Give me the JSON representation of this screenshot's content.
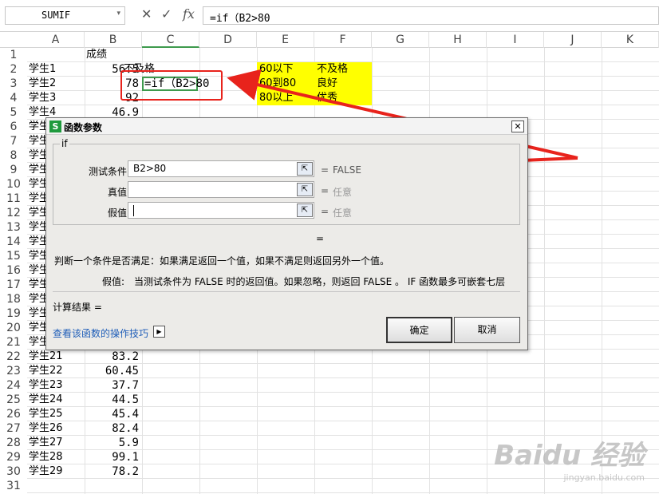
{
  "formula_bar": {
    "name_box": "SUMIF",
    "cancel_icon": "✕",
    "enter_icon": "✓",
    "fx_icon": "fx",
    "formula": "=if（B2>80"
  },
  "columns": [
    "A",
    "B",
    "C",
    "D",
    "E",
    "F",
    "G",
    "H",
    "I",
    "J",
    "K"
  ],
  "rows": [
    "1",
    "2",
    "3",
    "4",
    "5",
    "6",
    "7",
    "8",
    "9",
    "10",
    "11",
    "12",
    "13",
    "14",
    "15",
    "16",
    "17",
    "18",
    "19",
    "20",
    "21",
    "22",
    "23",
    "24",
    "25",
    "26",
    "27",
    "28",
    "29",
    "30",
    "31"
  ],
  "sheet": {
    "b1": "成绩",
    "visible_rows_top": [
      {
        "a": "学生1",
        "b": "56.5",
        "c": "不及格"
      },
      {
        "a": "学生2",
        "b": "78",
        "c": "=if（B2>80"
      },
      {
        "a": "学生3",
        "b": "92"
      },
      {
        "a": "学生4",
        "b": "46.9"
      }
    ],
    "hidden_a_prefix": "学生",
    "visible_rows_bottom": [
      {
        "a": "学生21",
        "b": "83.2"
      },
      {
        "a": "学生22",
        "b": "60.45"
      },
      {
        "a": "学生23",
        "b": "37.7"
      },
      {
        "a": "学生24",
        "b": "44.5"
      },
      {
        "a": "学生25",
        "b": "45.4"
      },
      {
        "a": "学生26",
        "b": "82.4"
      },
      {
        "a": "学生27",
        "b": "5.9"
      },
      {
        "a": "学生28",
        "b": "99.1"
      },
      {
        "a": "学生29",
        "b": "78.2"
      }
    ],
    "legend": [
      {
        "e": "60以下",
        "f": "不及格"
      },
      {
        "e": "60到80",
        "f": "良好"
      },
      {
        "e": "80以上",
        "f": "优秀"
      }
    ]
  },
  "dialog": {
    "title": "函数参数",
    "logo": "S",
    "close": "✕",
    "group": "if",
    "params": [
      {
        "label": "测试条件",
        "value": "B2>80",
        "result": "FALSE"
      },
      {
        "label": "真值",
        "value": "",
        "result": "任意"
      },
      {
        "label": "假值",
        "value": "",
        "result": "任意"
      }
    ],
    "equals": "=",
    "func_desc": "判断一个条件是否满足：如果满足返回一个值，如果不满足则返回另外一个值。",
    "param_desc_label": "假值:",
    "param_desc": "当测试条件为 FALSE 时的返回值。如果忽略，则返回 FALSE 。 IF 函数最多可嵌套七层",
    "calc_result": "计算结果 =",
    "help_link": "查看该函数的操作技巧",
    "ok": "确定",
    "cancel": "取消"
  },
  "watermark": {
    "main": "Baidu 经验",
    "sub": "jingyan.baidu.com"
  },
  "colors": {
    "highlight": "#ffff00",
    "annotation": "#e8231c",
    "selected_col": "#3e9a4d"
  }
}
